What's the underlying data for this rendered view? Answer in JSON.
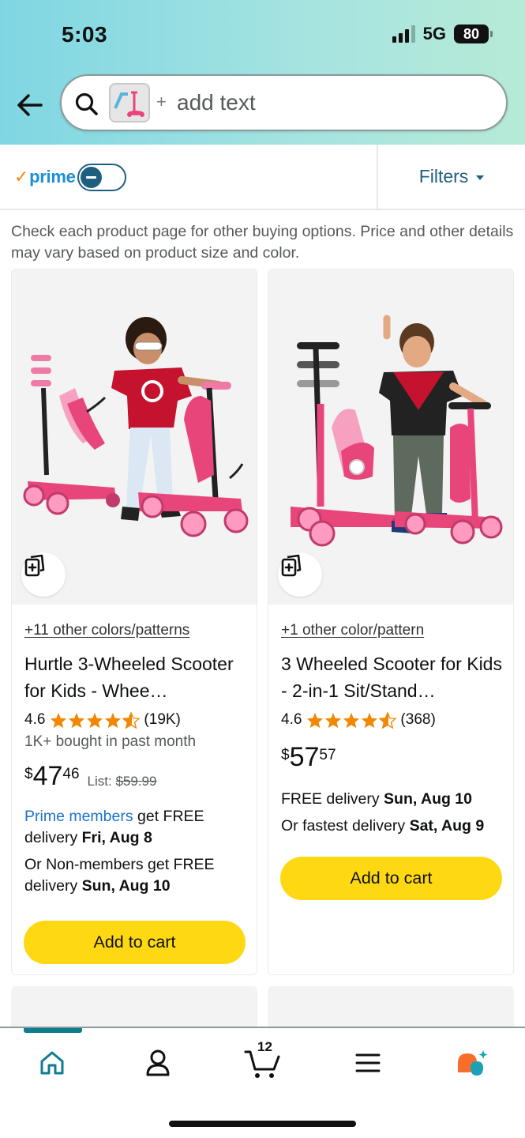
{
  "status_bar": {
    "time": "5:03",
    "network": "5G",
    "battery": "80"
  },
  "search": {
    "plus": "+",
    "placeholder": "add text"
  },
  "filter_bar": {
    "prime_label": "prime",
    "filters_label": "Filters"
  },
  "disclaimer": "Check each product page for other buying options. Price and other details may vary based on product size and color.",
  "products": [
    {
      "colors_link": "+11 other colors/patterns",
      "title": "Hurtle 3-Wheeled Scooter for Kids - Whee…",
      "rating": "4.6",
      "rating_count": "(19K)",
      "bought": "1K+ bought in past month",
      "price_symbol": "$",
      "price_whole": "47",
      "price_fraction": "46",
      "list_label": "List:",
      "list_price": "$59.99",
      "delivery_prime_link": "Prime members",
      "delivery_prime_rest": " get FREE delivery ",
      "delivery_prime_date": "Fri, Aug 8",
      "delivery_nonmember_rest": "Or Non-members get FREE delivery ",
      "delivery_nonmember_date": "Sun, Aug 10",
      "add_to_cart": "Add to cart"
    },
    {
      "colors_link": "+1 other color/pattern",
      "title": "3 Wheeled Scooter for Kids - 2-in-1 Sit/Stand…",
      "rating": "4.6",
      "rating_count": "(368)",
      "price_symbol": "$",
      "price_whole": "57",
      "price_fraction": "57",
      "delivery_free_rest": "FREE delivery ",
      "delivery_free_date": "Sun, Aug 10",
      "delivery_fast_rest": "Or fastest delivery ",
      "delivery_fast_date": "Sat, Aug 9",
      "add_to_cart": "Add to cart"
    }
  ],
  "bottom_nav": {
    "cart_count": "12"
  },
  "colors": {
    "accent_teal": "#0f7c8f",
    "prime_blue": "#1a8fd8",
    "cart_yellow": "#ffd814",
    "star_orange": "#f08804"
  }
}
